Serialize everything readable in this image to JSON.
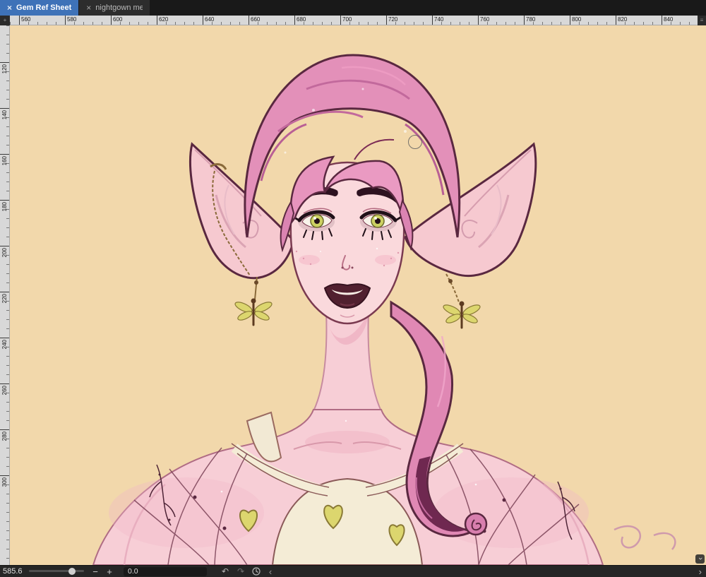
{
  "window": {
    "tabs": [
      {
        "label": "Gem Ref Sheet",
        "close_label": "×"
      },
      {
        "label": "nightgown me",
        "close_label": "×"
      }
    ]
  },
  "rulers": {
    "horizontal_ticks": [
      "560",
      "580",
      "600",
      "620",
      "640",
      "660",
      "680",
      "700",
      "720",
      "740",
      "760",
      "780",
      "800",
      "820",
      "840"
    ],
    "vertical_ticks": [
      "120",
      "140",
      "160",
      "180",
      "200",
      "220",
      "240",
      "260",
      "280",
      "300"
    ]
  },
  "statusbar": {
    "zoom_value": "585.6",
    "rotation_value": "0.0",
    "zoom_out_label": "−",
    "zoom_in_label": "+",
    "undo_icon": "↶",
    "redo_icon": "↷",
    "collapse_chevron": "‹",
    "expand_chevron": "›",
    "scroll_down_chevron": "›"
  },
  "artwork": {
    "subject": "digital painting of a pink-haired elf with long pointed ears, chain ear cuff, dragonfly earrings, yellow-green eyes, dark lips and a cream nightgown with yellow-green hearts",
    "colors": {
      "canvas_background": "#f2d8ab",
      "hair_pink": "#e390b9",
      "hair_dark": "#6f2850",
      "skin": "#f8d4d8",
      "outline": "#5a2840",
      "gown_cream": "#f4ecd6",
      "heart_green": "#dcd66e",
      "gold": "#8a6a3a",
      "iris_green": "#ccd162"
    }
  }
}
